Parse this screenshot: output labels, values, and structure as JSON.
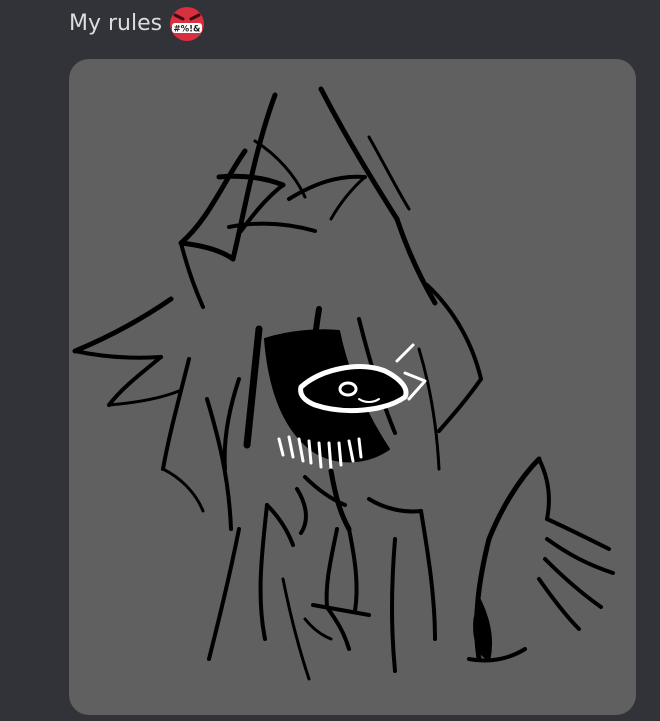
{
  "message": {
    "text": "My rules",
    "emoji": {
      "icon": "angry-cursing-face-icon",
      "symbols": "#%!&"
    }
  },
  "attachment": {
    "icon": "image-attachment",
    "background_color": "#606060"
  },
  "colors": {
    "app_background": "#313338",
    "message_text": "#dbdee1",
    "emoji_face": "#d9303f"
  }
}
